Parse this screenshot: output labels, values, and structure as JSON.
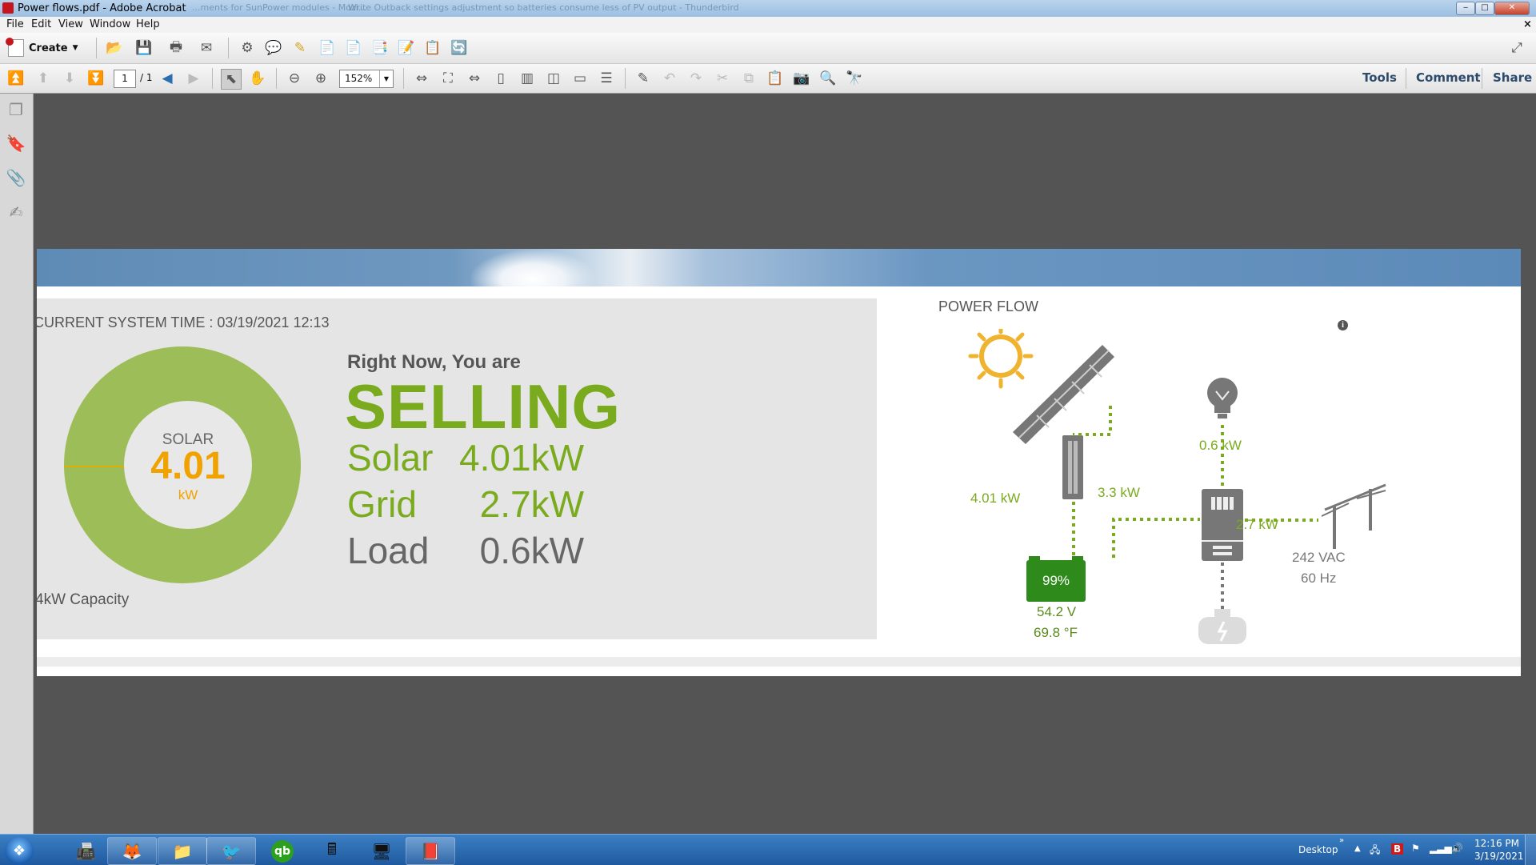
{
  "window": {
    "title": "Power flows.pdf - Adobe Acrobat",
    "bg_tab_1": "...ments for SunPower modules - Mozi...",
    "bg_tab_2": "Write Outback settings adjustment so batteries consume less of PV output - Thunderbird",
    "minimize": "‒",
    "maximize": "□",
    "close": "✕"
  },
  "menu": [
    "File",
    "Edit",
    "View",
    "Window",
    "Help"
  ],
  "toolbar": {
    "create_label": "Create",
    "page_current": "1",
    "page_total": "/ 1",
    "zoom": "152%",
    "tools_label": "Tools",
    "comment_label": "Comment",
    "share_label": "Share"
  },
  "dashboard": {
    "system_time": "CURRENT SYSTEM TIME : 03/19/2021 12:13",
    "donut": {
      "label": "SOLAR",
      "value": "4.01",
      "unit": "kW",
      "capacity": "4kW Capacity"
    },
    "right_now": "Right Now, You are",
    "status": "SELLING",
    "rows": [
      {
        "key": "Solar",
        "value": "4.01kW",
        "color": "#7aab1f"
      },
      {
        "key": "Grid",
        "value": "2.7kW",
        "color": "#7aab1f"
      },
      {
        "key": "Load",
        "value": "0.6kW",
        "color": "#666666"
      }
    ]
  },
  "power_flow": {
    "title": "POWER FLOW",
    "info_icon": "i",
    "solar_kw": "4.01 kW",
    "load_kw": "0.6 kW",
    "battery_kw": "3.3 kW",
    "grid_kw": "2.7 kW",
    "battery_percent": "99%",
    "battery_voltage": "54.2 V",
    "battery_temp": "69.8 °F",
    "grid_voltage": "242 VAC",
    "grid_freq": "60 Hz",
    "colors": {
      "flow": "#7aab1f",
      "battery": "#2f8a1c",
      "sun": "#f0b330",
      "equipment": "#666666"
    }
  },
  "taskbar": {
    "desktop_label": "Desktop",
    "time": "12:16 PM",
    "date": "3/19/2021",
    "apps": [
      "outlook-icon",
      "firefox-icon",
      "folder-icon",
      "thunderbird-icon",
      "quickbooks-icon",
      "calculator-icon",
      "remote-desktop-icon",
      "acrobat-icon"
    ]
  }
}
